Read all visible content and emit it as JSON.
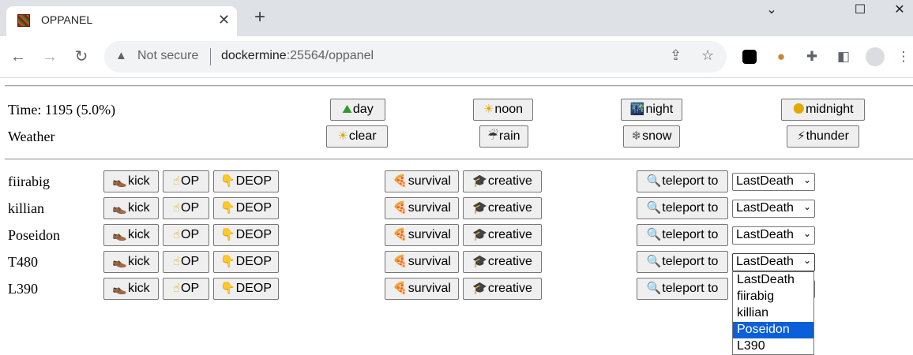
{
  "browser": {
    "tab_title": "OPPANEL",
    "tab_close": "✕",
    "new_tab": "+",
    "minimize": "⌄",
    "maximize": "☐",
    "close_window": "✕",
    "back": "←",
    "forward": "→",
    "reload": "↻",
    "security_label": "Not secure",
    "url_host": "dockermine",
    "url_rest": ":25564/oppanel",
    "icons": [
      "share-icon",
      "star-icon",
      "extension-tampermonkey-icon",
      "cookie-icon",
      "puzzle-icon",
      "sidepanel-icon",
      "profile-icon",
      "menu-icon"
    ]
  },
  "panel": {
    "time_label": "Time: 1195 (5.0%)",
    "weather_label": "Weather",
    "time_buttons": [
      {
        "icon": "⛰",
        "label": "day"
      },
      {
        "icon": "☀",
        "label": "noon"
      },
      {
        "icon": "🌃",
        "label": "night"
      },
      {
        "icon": "🌑",
        "label": "midnight"
      }
    ],
    "weather_buttons": [
      {
        "icon": "☀",
        "label": "clear"
      },
      {
        "icon": "☔",
        "label": "rain"
      },
      {
        "icon": "❄",
        "label": "snow"
      },
      {
        "icon": "⚡",
        "label": "thunder"
      }
    ],
    "actions": {
      "kick_icon": "👞",
      "kick": "kick",
      "op_icon": "☝",
      "op": "OP",
      "deop_icon": "👇",
      "deop": "DEOP",
      "survival_icon": "🍕",
      "survival": "survival",
      "creative_icon": "🎓",
      "creative": "creative",
      "teleport_icon": "🔍",
      "teleport": "teleport to"
    },
    "players": [
      {
        "name": "fiirabig",
        "target": "LastDeath"
      },
      {
        "name": "killian",
        "target": "LastDeath"
      },
      {
        "name": "Poseidon",
        "target": "LastDeath"
      },
      {
        "name": "T480",
        "target": "LastDeath"
      },
      {
        "name": "L390",
        "target": ""
      }
    ],
    "dropdown_options": [
      "LastDeath",
      "fiirabig",
      "killian",
      "Poseidon",
      "L390"
    ],
    "dropdown_highlighted": "Poseidon"
  }
}
